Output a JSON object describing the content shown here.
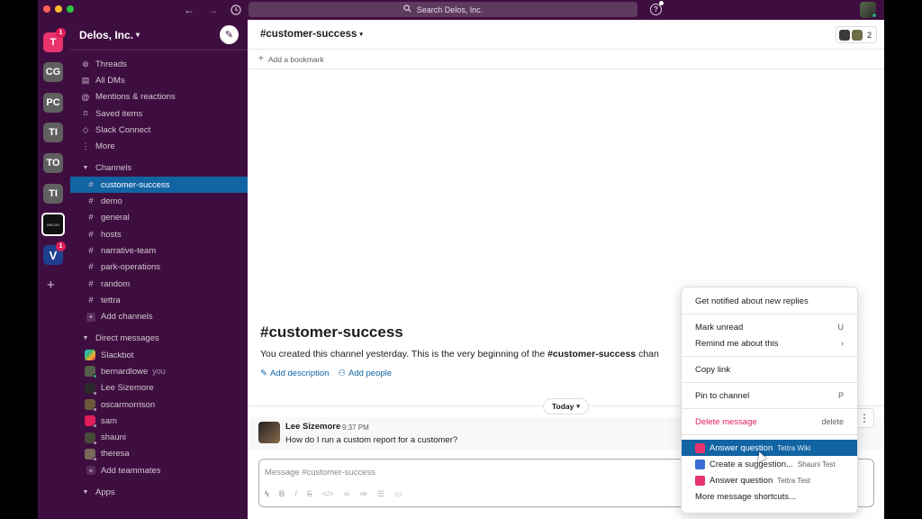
{
  "topbar": {
    "search_placeholder": "Search Delos, Inc.",
    "help_icon": "question-circle-icon"
  },
  "rail": {
    "workspaces": [
      {
        "label": "T",
        "badge": "1"
      },
      {
        "label": "CG"
      },
      {
        "label": "PC"
      },
      {
        "label": "TI"
      },
      {
        "label": "TO"
      },
      {
        "label": "TI"
      },
      {
        "label": "DELOS"
      },
      {
        "label": "V",
        "badge": "1"
      }
    ],
    "add_label": "+"
  },
  "sidebar": {
    "workspace_name": "Delos, Inc.",
    "nav": [
      {
        "icon": "threads-icon",
        "label": "Threads"
      },
      {
        "icon": "all-dms-icon",
        "label": "All DMs"
      },
      {
        "icon": "mentions-icon",
        "label": "Mentions & reactions"
      },
      {
        "icon": "bookmark-icon",
        "label": "Saved items"
      },
      {
        "icon": "slack-connect-icon",
        "label": "Slack Connect"
      },
      {
        "icon": "more-icon",
        "label": "More"
      }
    ],
    "channels_header": "Channels",
    "channels": [
      "customer-success",
      "demo",
      "general",
      "hosts",
      "narrative-team",
      "park-operations",
      "random",
      "tettra"
    ],
    "add_channels": "Add channels",
    "dm_header": "Direct messages",
    "dms": [
      {
        "name": "Slackbot",
        "you": ""
      },
      {
        "name": "bernardlowe",
        "you": "you"
      },
      {
        "name": "Lee Sizemore",
        "you": ""
      },
      {
        "name": "oscarmorrison",
        "you": ""
      },
      {
        "name": "sam",
        "you": ""
      },
      {
        "name": "shauni",
        "you": ""
      },
      {
        "name": "theresa",
        "you": ""
      }
    ],
    "add_teammates": "Add teammates",
    "apps_header": "Apps"
  },
  "main": {
    "channel_name": "#customer-success",
    "member_count": "2",
    "bookmark": "Add a bookmark",
    "intro_title": "#customer-success",
    "intro_text_before": "You created this channel yesterday. This is the very beginning of the ",
    "intro_text_channel": "#customer-success",
    "intro_text_after": " chan",
    "add_description": "Add description",
    "add_people": "Add people",
    "today": "Today",
    "message": {
      "author": "Lee Sizemore",
      "time": "9:37 PM",
      "text": "How do I run a custom report for a customer?"
    },
    "composer_placeholder": "Message #customer-success"
  },
  "menu": {
    "notify": "Get notified about new replies",
    "mark_unread": "Mark unread",
    "mark_unread_key": "U",
    "remind": "Remind me about this",
    "remind_key": "›",
    "copy_link": "Copy link",
    "pin": "Pin to channel",
    "pin_key": "P",
    "delete": "Delete message",
    "delete_key": "delete",
    "shortcuts": [
      {
        "label": "Answer question",
        "source": "Tettra Wiki"
      },
      {
        "label": "Create a suggestion...",
        "source": "Shauni Test"
      },
      {
        "label": "Answer question",
        "source": "Tettra Test"
      }
    ],
    "more_shortcuts": "More message shortcuts..."
  },
  "colors": {
    "aubergine": "#3f0e40",
    "active_blue": "#1264a3",
    "danger": "#e01e5a"
  }
}
